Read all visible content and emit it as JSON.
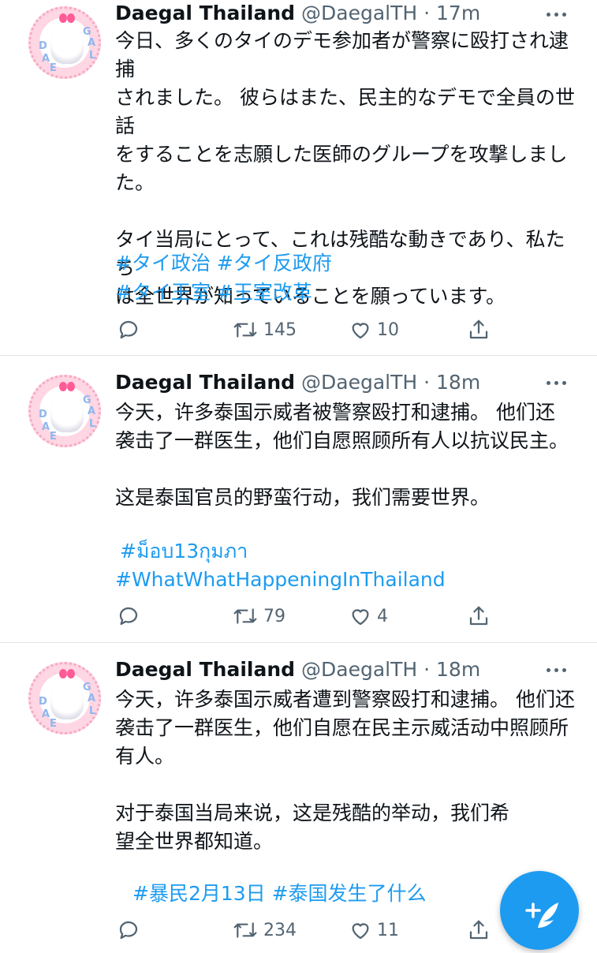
{
  "tweets": [
    {
      "name": "Daegal Thailand",
      "handle": "@DaegalTH",
      "time": "· 17m",
      "text": "今日、多くのタイのデモ参加者が警察に殴打され逮捕\nされました。 彼らはまた、民主的なデモで全員の世話\nをすることを志願した医師のグループを攻撃しまし\nた。\n\nタイ当局にとって、これは残酷な動きであり、私たち\nは全世界が知っていることを願っています。",
      "hashtags_line1": "#タイ政治 #タイ反政府",
      "hashtags_line2": "#タイ王室 #王室改革",
      "retweets": "145",
      "likes": "10"
    },
    {
      "name": "Daegal Thailand",
      "handle": "@DaegalTH",
      "time": "· 18m",
      "text": "今天，许多泰国示威者被警察殴打和逮捕。 他们还\n袭击了一群医生，他们自愿照顾所有人以抗议民主。\n\n这是泰国官员的野蛮行动，我们需要世界。",
      "hashtags_line1": "#ม็อบ13กุมภา",
      "hashtags_line2": "#WhatWhatHappeningInThailand",
      "retweets": "79",
      "likes": "4"
    },
    {
      "name": "Daegal Thailand",
      "handle": "@DaegalTH",
      "time": "· 18m",
      "text": "今天，许多泰国示威者遭到警察殴打和逮捕。 他们还\n袭击了一群医生，他们自愿在民主示威活动中照顾所\n有人。\n\n对于泰国当局来说，这是残酷的举动，我们希\n望全世界都知道。",
      "hashtags_line1": "#暴民2月13日 #泰国发生了什么",
      "retweets": "234",
      "likes": "11"
    }
  ],
  "avatar_letters": [
    "D",
    "A",
    "E",
    "G",
    "A",
    "L"
  ],
  "colors": {
    "link": "#1d9bf0",
    "secondary_text": "#536471",
    "divider": "#dfe3e6",
    "fab": "#1d9bf0"
  },
  "icons": {
    "reply": "reply-icon",
    "retweet": "retweet-icon",
    "like": "heart-icon",
    "share": "share-icon",
    "more": "more-options-icon",
    "compose": "compose-tweet-icon"
  }
}
